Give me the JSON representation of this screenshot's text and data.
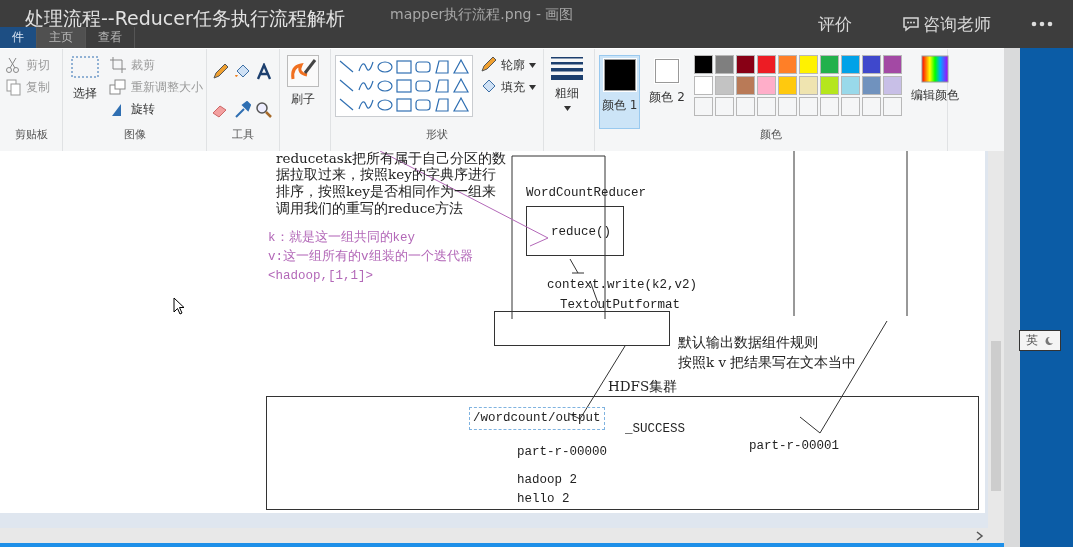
{
  "overlay": {
    "title": "处理流程--Reducer任务执行流程解析",
    "actions": [
      {
        "label": "评价",
        "kind": "text"
      },
      {
        "label": "咨询老师",
        "kind": "chat"
      },
      {
        "kind": "more"
      }
    ]
  },
  "window": {
    "title": "mapper执行流程.png - 画图"
  },
  "tabs": [
    {
      "label": "件",
      "kind": "file",
      "selected": false
    },
    {
      "label": "主页",
      "kind": "tab",
      "selected": true
    },
    {
      "label": "查看",
      "kind": "tab",
      "selected": false
    }
  ],
  "ribbon": {
    "clipboard": {
      "label": "剪贴板",
      "items": [
        "剪切",
        "复制"
      ]
    },
    "image": {
      "label": "图像",
      "select": "选择",
      "items": [
        "裁剪",
        "重新调整大小",
        "旋转"
      ]
    },
    "tools": {
      "label": "工具"
    },
    "brush": {
      "label": "刷子"
    },
    "shapes": {
      "label": "形状",
      "items": [
        "轮廓",
        "填充"
      ]
    },
    "size": {
      "label": "粗细"
    },
    "colors": {
      "label": "颜色",
      "current": [
        {
          "label": "颜色 1",
          "color": "#000000",
          "selected": true
        },
        {
          "label": "颜色 2",
          "color": "#ffffff",
          "selected": false
        }
      ],
      "palette": [
        {
          "color": "#000000"
        },
        {
          "color": "#7f7f7f"
        },
        {
          "color": "#880015"
        },
        {
          "color": "#ed1c24"
        },
        {
          "color": "#ff7f27"
        },
        {
          "color": "#fff200"
        },
        {
          "color": "#22b14c"
        },
        {
          "color": "#00a2e8"
        },
        {
          "color": "#3f48cc"
        },
        {
          "color": "#a349a4"
        },
        {
          "color": "#ffffff"
        },
        {
          "color": "#c3c3c3"
        },
        {
          "color": "#b97a57"
        },
        {
          "color": "#ffaec9"
        },
        {
          "color": "#ffc90e"
        },
        {
          "color": "#efe4b0"
        },
        {
          "color": "#b5e61d"
        },
        {
          "color": "#99d9ea"
        },
        {
          "color": "#7092be"
        },
        {
          "color": "#c8bfe7"
        }
      ],
      "edit": "编辑颜色"
    }
  },
  "canvas": {
    "texts": [
      {
        "text": "reducetask把所有属于自己分区的数",
        "kind": "note"
      },
      {
        "text": "据拉取过来，按照key的字典序进行",
        "kind": "note"
      },
      {
        "text": "排序，按照key是否相同作为一组来",
        "kind": "note"
      },
      {
        "text": "调用我们的重写的reduce方法",
        "kind": "note"
      },
      {
        "text": "k：就是这一组共同的key",
        "kind": "comment"
      },
      {
        "text": "v:这一组所有的v组装的一个迭代器",
        "kind": "comment"
      },
      {
        "text": "<hadoop,[1,1]>",
        "kind": "comment"
      },
      {
        "text": "WordCountReducer",
        "kind": "code"
      },
      {
        "text": "reduce()",
        "kind": "code"
      },
      {
        "text": "context.write(k2,v2)",
        "kind": "code"
      },
      {
        "text": "TextoutPutformat",
        "kind": "code"
      },
      {
        "text": "默认输出数据组件规则",
        "kind": "note"
      },
      {
        "text": "按照k v 把结果写在文本当中",
        "kind": "note"
      },
      {
        "text": "HDFS集群",
        "kind": "note"
      },
      {
        "text": "/wordcount/output",
        "kind": "selection"
      },
      {
        "text": "_SUCCESS",
        "kind": "code"
      },
      {
        "text": "part-r-00000",
        "kind": "code"
      },
      {
        "text": "part-r-00001",
        "kind": "code"
      },
      {
        "text": "hadoop 2",
        "kind": "code"
      },
      {
        "text": "hello 2",
        "kind": "code"
      }
    ]
  },
  "ime": {
    "label": "英"
  }
}
